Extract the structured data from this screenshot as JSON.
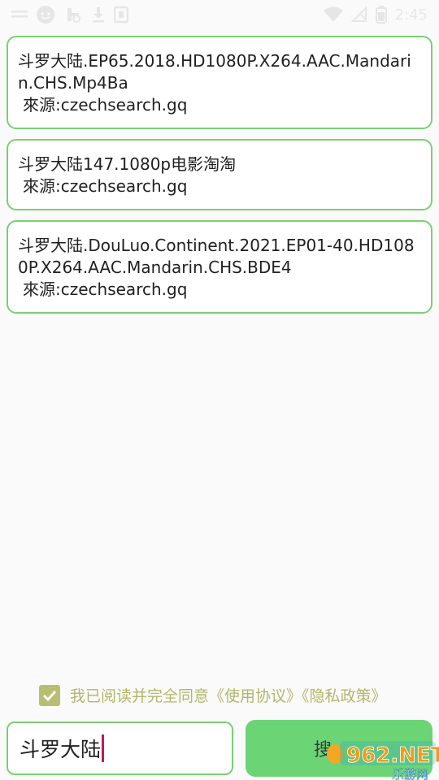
{
  "status_bar": {
    "time": "2:45",
    "icons": [
      "signal-icon",
      "messenger-icon",
      "settings-icon",
      "download-icon",
      "app-icon",
      "wifi-icon",
      "no-sim-icon",
      "battery-icon"
    ]
  },
  "results": [
    {
      "title": "斗罗大陆.EP65.2018.HD1080P.X264.AAC.Mandarin.CHS.Mp4Ba",
      "source": "來源:czechsearch.gq"
    },
    {
      "title": "斗罗大陆147.1080p电影淘淘",
      "source": "來源:czechsearch.gq"
    },
    {
      "title": "斗罗大陆.DouLuo.Continent.2021.EP01-40.HD1080P.X264.AAC.Mandarin.CHS.BDE4",
      "source": "來源:czechsearch.gq"
    }
  ],
  "agreement": {
    "checked": true,
    "text": "我已阅读并完全同意《使用协议》《隐私政策》"
  },
  "search": {
    "value": "斗罗大陆",
    "button_label": "搜"
  },
  "watermark": {
    "text_main": "962.NET",
    "text_sub": "乐游网"
  },
  "colors": {
    "accent": "#7ccf73",
    "button": "#6bd576",
    "checkbox": "#b9bd72",
    "caret": "#c2185b"
  }
}
